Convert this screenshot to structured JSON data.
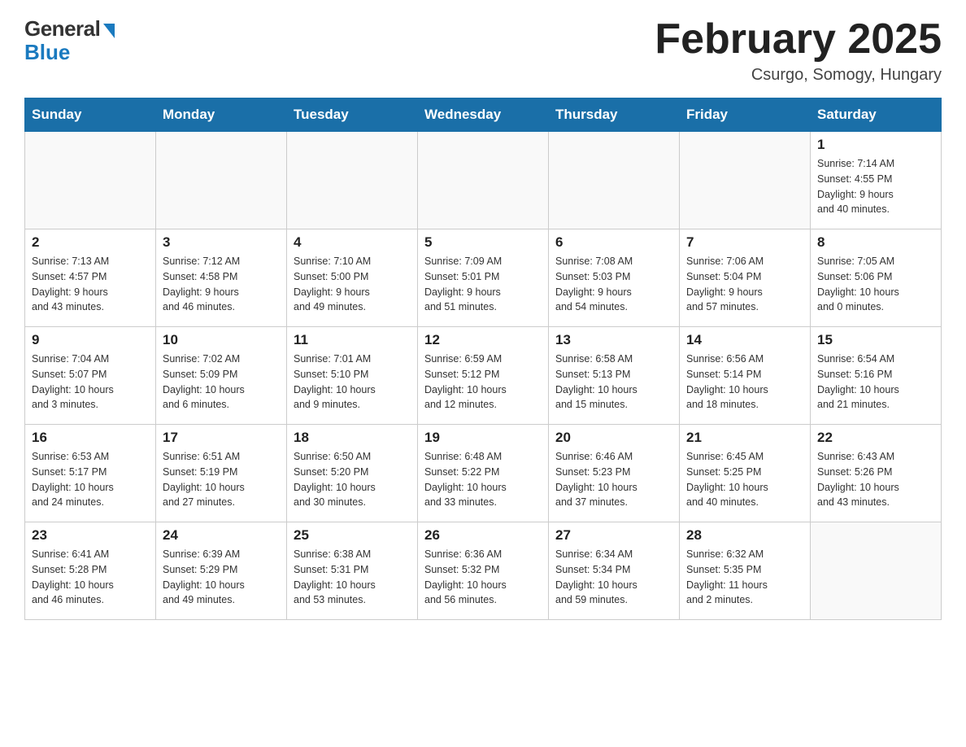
{
  "header": {
    "logo_general": "General",
    "logo_blue": "Blue",
    "title": "February 2025",
    "location": "Csurgo, Somogy, Hungary"
  },
  "days_of_week": [
    "Sunday",
    "Monday",
    "Tuesday",
    "Wednesday",
    "Thursday",
    "Friday",
    "Saturday"
  ],
  "weeks": [
    [
      {
        "day": "",
        "info": ""
      },
      {
        "day": "",
        "info": ""
      },
      {
        "day": "",
        "info": ""
      },
      {
        "day": "",
        "info": ""
      },
      {
        "day": "",
        "info": ""
      },
      {
        "day": "",
        "info": ""
      },
      {
        "day": "1",
        "info": "Sunrise: 7:14 AM\nSunset: 4:55 PM\nDaylight: 9 hours\nand 40 minutes."
      }
    ],
    [
      {
        "day": "2",
        "info": "Sunrise: 7:13 AM\nSunset: 4:57 PM\nDaylight: 9 hours\nand 43 minutes."
      },
      {
        "day": "3",
        "info": "Sunrise: 7:12 AM\nSunset: 4:58 PM\nDaylight: 9 hours\nand 46 minutes."
      },
      {
        "day": "4",
        "info": "Sunrise: 7:10 AM\nSunset: 5:00 PM\nDaylight: 9 hours\nand 49 minutes."
      },
      {
        "day": "5",
        "info": "Sunrise: 7:09 AM\nSunset: 5:01 PM\nDaylight: 9 hours\nand 51 minutes."
      },
      {
        "day": "6",
        "info": "Sunrise: 7:08 AM\nSunset: 5:03 PM\nDaylight: 9 hours\nand 54 minutes."
      },
      {
        "day": "7",
        "info": "Sunrise: 7:06 AM\nSunset: 5:04 PM\nDaylight: 9 hours\nand 57 minutes."
      },
      {
        "day": "8",
        "info": "Sunrise: 7:05 AM\nSunset: 5:06 PM\nDaylight: 10 hours\nand 0 minutes."
      }
    ],
    [
      {
        "day": "9",
        "info": "Sunrise: 7:04 AM\nSunset: 5:07 PM\nDaylight: 10 hours\nand 3 minutes."
      },
      {
        "day": "10",
        "info": "Sunrise: 7:02 AM\nSunset: 5:09 PM\nDaylight: 10 hours\nand 6 minutes."
      },
      {
        "day": "11",
        "info": "Sunrise: 7:01 AM\nSunset: 5:10 PM\nDaylight: 10 hours\nand 9 minutes."
      },
      {
        "day": "12",
        "info": "Sunrise: 6:59 AM\nSunset: 5:12 PM\nDaylight: 10 hours\nand 12 minutes."
      },
      {
        "day": "13",
        "info": "Sunrise: 6:58 AM\nSunset: 5:13 PM\nDaylight: 10 hours\nand 15 minutes."
      },
      {
        "day": "14",
        "info": "Sunrise: 6:56 AM\nSunset: 5:14 PM\nDaylight: 10 hours\nand 18 minutes."
      },
      {
        "day": "15",
        "info": "Sunrise: 6:54 AM\nSunset: 5:16 PM\nDaylight: 10 hours\nand 21 minutes."
      }
    ],
    [
      {
        "day": "16",
        "info": "Sunrise: 6:53 AM\nSunset: 5:17 PM\nDaylight: 10 hours\nand 24 minutes."
      },
      {
        "day": "17",
        "info": "Sunrise: 6:51 AM\nSunset: 5:19 PM\nDaylight: 10 hours\nand 27 minutes."
      },
      {
        "day": "18",
        "info": "Sunrise: 6:50 AM\nSunset: 5:20 PM\nDaylight: 10 hours\nand 30 minutes."
      },
      {
        "day": "19",
        "info": "Sunrise: 6:48 AM\nSunset: 5:22 PM\nDaylight: 10 hours\nand 33 minutes."
      },
      {
        "day": "20",
        "info": "Sunrise: 6:46 AM\nSunset: 5:23 PM\nDaylight: 10 hours\nand 37 minutes."
      },
      {
        "day": "21",
        "info": "Sunrise: 6:45 AM\nSunset: 5:25 PM\nDaylight: 10 hours\nand 40 minutes."
      },
      {
        "day": "22",
        "info": "Sunrise: 6:43 AM\nSunset: 5:26 PM\nDaylight: 10 hours\nand 43 minutes."
      }
    ],
    [
      {
        "day": "23",
        "info": "Sunrise: 6:41 AM\nSunset: 5:28 PM\nDaylight: 10 hours\nand 46 minutes."
      },
      {
        "day": "24",
        "info": "Sunrise: 6:39 AM\nSunset: 5:29 PM\nDaylight: 10 hours\nand 49 minutes."
      },
      {
        "day": "25",
        "info": "Sunrise: 6:38 AM\nSunset: 5:31 PM\nDaylight: 10 hours\nand 53 minutes."
      },
      {
        "day": "26",
        "info": "Sunrise: 6:36 AM\nSunset: 5:32 PM\nDaylight: 10 hours\nand 56 minutes."
      },
      {
        "day": "27",
        "info": "Sunrise: 6:34 AM\nSunset: 5:34 PM\nDaylight: 10 hours\nand 59 minutes."
      },
      {
        "day": "28",
        "info": "Sunrise: 6:32 AM\nSunset: 5:35 PM\nDaylight: 11 hours\nand 2 minutes."
      },
      {
        "day": "",
        "info": ""
      }
    ]
  ]
}
